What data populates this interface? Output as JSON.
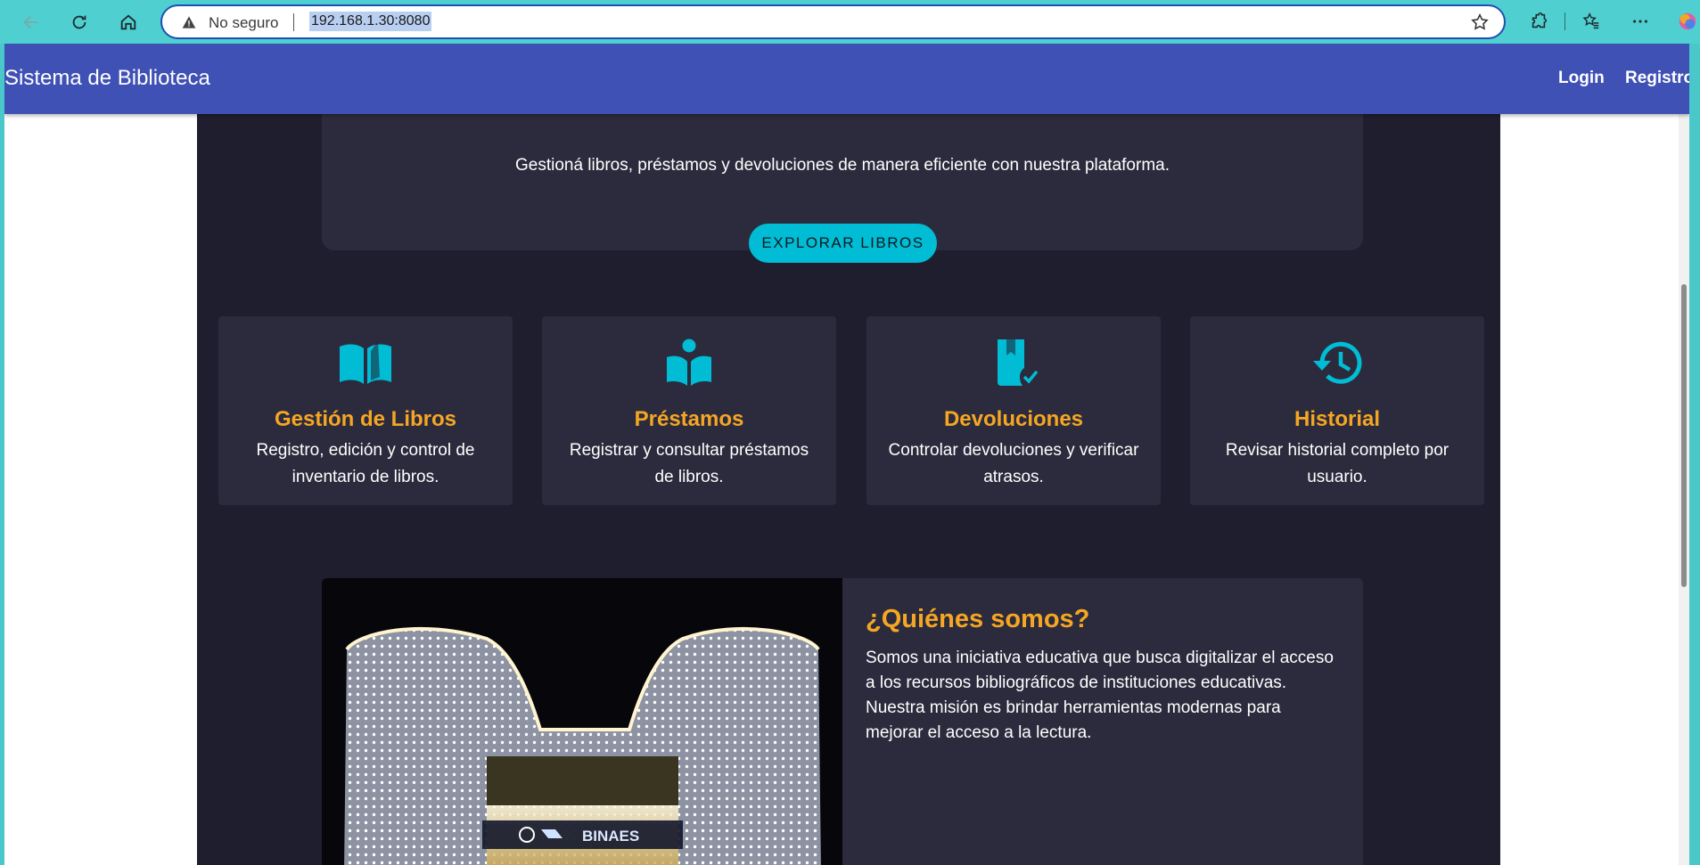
{
  "browser": {
    "security_label": "No seguro",
    "url": "192.168.1.30:8080"
  },
  "navbar": {
    "brand": "Sistema de Biblioteca",
    "links": [
      "Login",
      "Registro"
    ]
  },
  "hero": {
    "subtitle": "Gestioná libros, préstamos y devoluciones de manera eficiente con nuestra plataforma.",
    "button_label": "EXPLORAR LIBROS"
  },
  "features": [
    {
      "icon": "open-book-icon",
      "title": "Gestión de Libros",
      "description": "Registro, edición y control de inventario de libros."
    },
    {
      "icon": "reader-book-icon",
      "title": "Préstamos",
      "description": "Registrar y consultar préstamos de libros."
    },
    {
      "icon": "bookmark-check-icon",
      "title": "Devoluciones",
      "description": "Controlar devoluciones y verificar atrasos."
    },
    {
      "icon": "history-icon",
      "title": "Historial",
      "description": "Revisar historial completo por usuario."
    }
  ],
  "about": {
    "title": "¿Quiénes somos?",
    "text": "Somos una iniciativa educativa que busca digitalizar el acceso a los recursos bibliográficos de instituciones educativas. Nuestra misión es brindar herramientas modernas para mejorar el acceso a la lectura.",
    "image_sign": "BINAES"
  },
  "colors": {
    "navbar": "#3f51b5",
    "accent": "#00bcd4",
    "title_gold": "#f5a623",
    "background_dark": "#1f1e2e",
    "card_dark": "#2c2b3d"
  }
}
